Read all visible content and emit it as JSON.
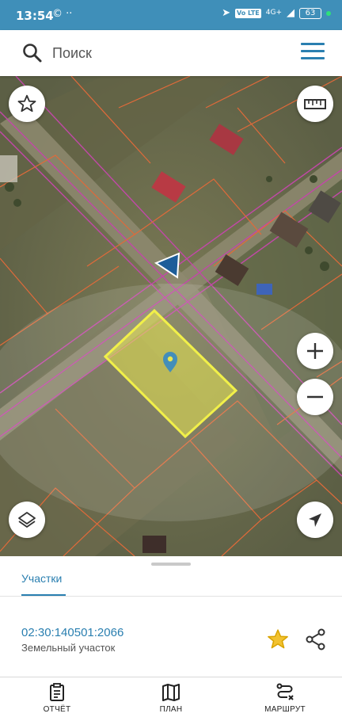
{
  "status_bar": {
    "time": "13:54",
    "left_icons": "© ··",
    "network_badge": "Vo LTE",
    "network_label": "4G+",
    "battery": "63"
  },
  "search": {
    "placeholder": "Поиск"
  },
  "map": {
    "selected_parcel_color": "#e6e43a",
    "boundary_color": "#e06a3a",
    "road_color": "#c248a8",
    "marker_color": "#2a7fb0"
  },
  "map_controls": {
    "favorites": "star-icon",
    "ruler": "ruler-icon",
    "zoom_in": "plus-icon",
    "zoom_out": "minus-icon",
    "layers": "layers-icon",
    "locate": "navigation-icon"
  },
  "sheet": {
    "tab_label": "Участки",
    "parcel": {
      "number": "02:30:140501:2066",
      "type": "Земельный участок"
    }
  },
  "bottom_nav": {
    "items": [
      {
        "label": "ОТЧЁТ",
        "icon": "report-icon"
      },
      {
        "label": "ПЛАН",
        "icon": "map-plan-icon"
      },
      {
        "label": "МАРШРУТ",
        "icon": "route-icon"
      }
    ]
  },
  "colors": {
    "accent": "#2a7fb0",
    "status_bar": "#3f8fb9",
    "star": "#f2c230"
  }
}
